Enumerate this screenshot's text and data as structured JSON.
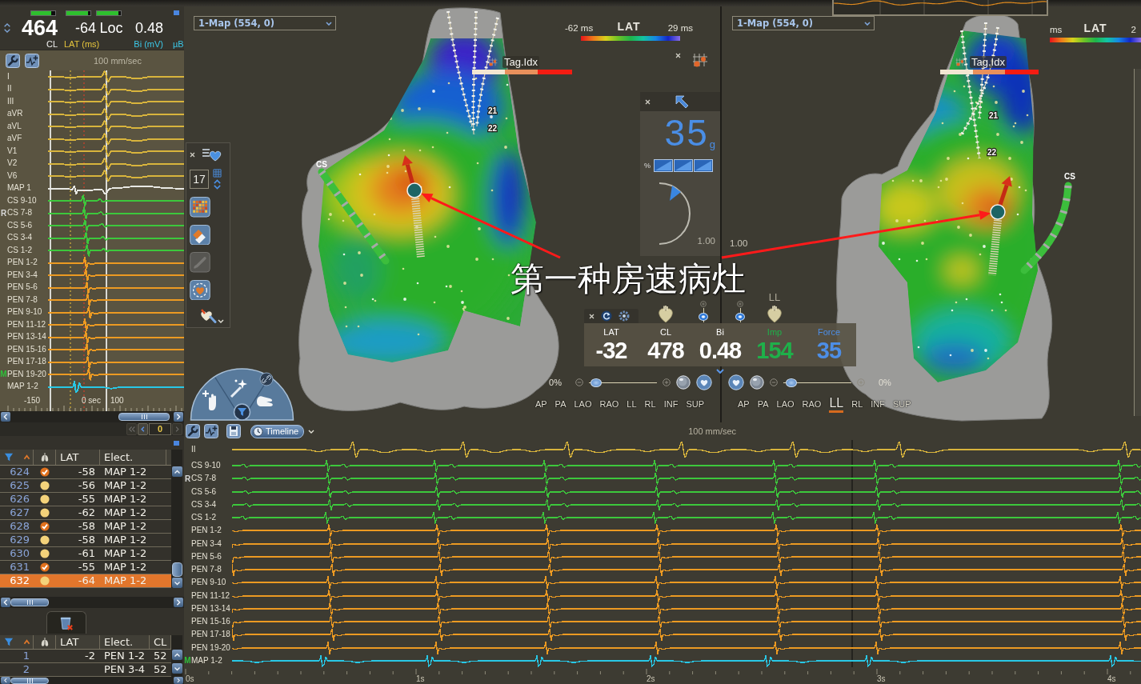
{
  "header": {
    "meters": [
      {
        "level": 0.82
      },
      {
        "level": 0.9
      },
      {
        "level": 0.9
      }
    ],
    "values": [
      "464",
      "-64",
      "Loc",
      "0.48"
    ],
    "labels": [
      {
        "text": "CL",
        "color": "#f2f2f2"
      },
      {
        "text": "LAT (ms)",
        "color": "#e4c43c"
      },
      {
        "text": "Bi (mV)",
        "color": "#3cc8e8"
      },
      {
        "text": "µB",
        "color": "#3cc8e8"
      }
    ]
  },
  "signal_panel": {
    "speed": "100 mm/sec",
    "channels": [
      {
        "label": "I",
        "kind": "surface",
        "color": "#d8b43c"
      },
      {
        "label": "II",
        "kind": "surface",
        "color": "#d8b43c"
      },
      {
        "label": "III",
        "kind": "surface",
        "color": "#d8b43c"
      },
      {
        "label": "aVR",
        "kind": "surface",
        "color": "#d8b43c"
      },
      {
        "label": "aVL",
        "kind": "surface",
        "color": "#d8b43c"
      },
      {
        "label": "aVF",
        "kind": "surface",
        "color": "#d8b43c"
      },
      {
        "label": "V1",
        "kind": "surface",
        "color": "#d8b43c"
      },
      {
        "label": "V2",
        "kind": "surface",
        "color": "#d8b43c"
      },
      {
        "label": "V6",
        "kind": "surface",
        "color": "#d8b43c"
      },
      {
        "label": "MAP 1",
        "kind": "unipolar",
        "color": "#e8e8e4"
      },
      {
        "label": "CS 9-10",
        "kind": "cs",
        "color": "#3cc83c"
      },
      {
        "label": "CS 7-8",
        "kind": "cs",
        "color": "#3cc83c",
        "marker": {
          "text": "R",
          "color": "#d8d8d8"
        }
      },
      {
        "label": "CS 5-6",
        "kind": "cs",
        "color": "#3cc83c"
      },
      {
        "label": "CS 3-4",
        "kind": "cs",
        "color": "#3cc83c"
      },
      {
        "label": "CS 1-2",
        "kind": "cs",
        "color": "#3cc83c"
      },
      {
        "label": "PEN 1-2",
        "kind": "pen",
        "color": "#ec9a22"
      },
      {
        "label": "PEN 3-4",
        "kind": "pen",
        "color": "#ec9a22"
      },
      {
        "label": "PEN 5-6",
        "kind": "pen",
        "color": "#ec9a22"
      },
      {
        "label": "PEN 7-8",
        "kind": "pen",
        "color": "#ec9a22"
      },
      {
        "label": "PEN 9-10",
        "kind": "pen",
        "color": "#ec9a22"
      },
      {
        "label": "PEN 11-12",
        "kind": "pen",
        "color": "#ec9a22"
      },
      {
        "label": "PEN 13-14",
        "kind": "pen",
        "color": "#ec9a22"
      },
      {
        "label": "PEN 15-16",
        "kind": "pen",
        "color": "#ec9a22"
      },
      {
        "label": "PEN 17-18",
        "kind": "pen",
        "color": "#ec9a22"
      },
      {
        "label": "PEN 19-20",
        "kind": "pen",
        "color": "#ec9a22",
        "marker": {
          "text": "M",
          "color": "#2fbf3a"
        }
      },
      {
        "label": "MAP 1-2",
        "kind": "map",
        "color": "#28c8e6"
      }
    ],
    "window_start": "-150",
    "window_zero": "0 sec",
    "window_end": "100"
  },
  "pager": {
    "page": "0",
    "buttons": [
      {
        "kind": "first",
        "disabled": true
      },
      {
        "kind": "previous",
        "disabled": false
      },
      {
        "kind": "next",
        "disabled": true
      }
    ]
  },
  "point_table": {
    "columns": [
      "LAT",
      "Elect."
    ],
    "rows": [
      {
        "id": "624",
        "checked": true,
        "lat": "-58",
        "electrode": "MAP 1-2",
        "selected": false
      },
      {
        "id": "625",
        "checked": false,
        "lat": "-56",
        "electrode": "MAP 1-2",
        "selected": false
      },
      {
        "id": "626",
        "checked": false,
        "lat": "-55",
        "electrode": "MAP 1-2",
        "selected": false
      },
      {
        "id": "627",
        "checked": false,
        "lat": "-62",
        "electrode": "MAP 1-2",
        "selected": false
      },
      {
        "id": "628",
        "checked": true,
        "lat": "-58",
        "electrode": "MAP 1-2",
        "selected": false
      },
      {
        "id": "629",
        "checked": false,
        "lat": "-58",
        "electrode": "MAP 1-2",
        "selected": false
      },
      {
        "id": "630",
        "checked": false,
        "lat": "-61",
        "electrode": "MAP 1-2",
        "selected": false
      },
      {
        "id": "631",
        "checked": true,
        "lat": "-55",
        "electrode": "MAP 1-2",
        "selected": false
      },
      {
        "id": "632",
        "checked": false,
        "lat": "-64",
        "electrode": "MAP 1-2",
        "selected": true
      }
    ]
  },
  "tag_table": {
    "columns": [
      "LAT",
      "Elect.",
      "CL"
    ],
    "rows": [
      {
        "id": "1",
        "lat": "-2",
        "electrode": "PEN 1-2",
        "cl": "52"
      },
      {
        "id": "2",
        "electrode": "PEN 3-4",
        "cl": "52"
      }
    ]
  },
  "maps": [
    {
      "selector": "1-Map (554, 0)",
      "lat_scale": {
        "min": "-62 ms",
        "title": "LAT",
        "max": "29 ms"
      },
      "tag_legend": "Tag.Idx",
      "catheter_label": "CS",
      "electrode_labels": [
        "21",
        "22"
      ],
      "depth_slider": {
        "level": 0.2
      },
      "zoom": {
        "readout": "0%",
        "level": 0.1
      },
      "views": [
        {
          "label": "AP",
          "selected": false
        },
        {
          "label": "PA",
          "selected": false
        },
        {
          "label": "LAO",
          "selected": false
        },
        {
          "label": "RAO",
          "selected": false
        },
        {
          "label": "LL",
          "selected": false
        },
        {
          "label": "RL",
          "selected": false
        },
        {
          "label": "INF",
          "selected": false
        },
        {
          "label": "SUP",
          "selected": false
        }
      ]
    },
    {
      "selector": "1-Map (554, 0)",
      "lat_scale": {
        "min": "ms",
        "title": "LAT",
        "max": "2"
      },
      "tag_legend": "Tag.Idx",
      "catheter_label": "CS",
      "electrode_labels": [
        "21",
        "22"
      ],
      "depth_slider": {
        "level": 0.2
      },
      "scale_label": "1.00",
      "zoom": {
        "readout": "0%",
        "level": 0.12
      },
      "views": [
        {
          "label": "AP",
          "selected": false
        },
        {
          "label": "PA",
          "selected": false
        },
        {
          "label": "LAO",
          "selected": false
        },
        {
          "label": "RAO",
          "selected": false
        },
        {
          "label": "LL",
          "selected": true
        },
        {
          "label": "RL",
          "selected": false
        },
        {
          "label": "INF",
          "selected": false
        },
        {
          "label": "SUP",
          "selected": false
        }
      ]
    }
  ],
  "map_tools": {
    "point_filter": "17",
    "buttons": [
      {
        "kind": "grid",
        "disabled": false
      },
      {
        "kind": "eraser",
        "disabled": false
      },
      {
        "kind": "brush",
        "disabled": true
      },
      {
        "kind": "heart",
        "disabled": false
      }
    ]
  },
  "force_panel": {
    "value": "35",
    "unit": "g",
    "percent_label": "%",
    "scale_label": "1.00"
  },
  "catheter_panel": {
    "orientation": "LL",
    "readings": [
      {
        "label": "LAT",
        "value": "-32",
        "color": "#ffffff"
      },
      {
        "label": "CL",
        "value": "478",
        "color": "#ffffff"
      },
      {
        "label": "Bi",
        "value": "0.48",
        "color": "#ffffff"
      },
      {
        "label": "Imp",
        "value": "154",
        "color": "#1fb04a"
      },
      {
        "label": "Force",
        "value": "35",
        "color": "#4d8ee6"
      }
    ]
  },
  "annotation": {
    "text": "第一种房速病灶"
  },
  "strip": {
    "timeline_button": "Timeline",
    "speed": "100 mm/sec",
    "channels": [
      {
        "label": "II",
        "kind": "surface",
        "color": "#d8b43c"
      },
      {
        "label": "CS 9-10",
        "kind": "cs",
        "color": "#3cc83c"
      },
      {
        "label": "CS 7-8",
        "kind": "cs",
        "color": "#3cc83c",
        "marker": {
          "text": "R",
          "color": "#d8d8d8"
        }
      },
      {
        "label": "CS 5-6",
        "kind": "cs",
        "color": "#3cc83c"
      },
      {
        "label": "CS 3-4",
        "kind": "cs",
        "color": "#3cc83c"
      },
      {
        "label": "CS 1-2",
        "kind": "cs",
        "color": "#3cc83c"
      },
      {
        "label": "PEN 1-2",
        "kind": "pen",
        "color": "#ec9a22"
      },
      {
        "label": "PEN 3-4",
        "kind": "pen",
        "color": "#ec9a22"
      },
      {
        "label": "PEN 5-6",
        "kind": "pen",
        "color": "#ec9a22"
      },
      {
        "label": "PEN 7-8",
        "kind": "pen",
        "color": "#ec9a22"
      },
      {
        "label": "PEN 9-10",
        "kind": "pen",
        "color": "#ec9a22"
      },
      {
        "label": "PEN 11-12",
        "kind": "pen",
        "color": "#ec9a22"
      },
      {
        "label": "PEN 13-14",
        "kind": "pen",
        "color": "#ec9a22"
      },
      {
        "label": "PEN 15-16",
        "kind": "pen",
        "color": "#ec9a22"
      },
      {
        "label": "PEN 17-18",
        "kind": "pen",
        "color": "#ec9a22"
      },
      {
        "label": "PEN 19-20",
        "kind": "pen",
        "color": "#ec9a22"
      },
      {
        "label": "MAP 1-2",
        "kind": "map",
        "color": "#28c8e6",
        "marker": {
          "text": "M",
          "color": "#2fbf3a"
        }
      }
    ],
    "time_ticks": [
      "0s",
      "1s",
      "2s",
      "3s",
      "4s"
    ]
  }
}
